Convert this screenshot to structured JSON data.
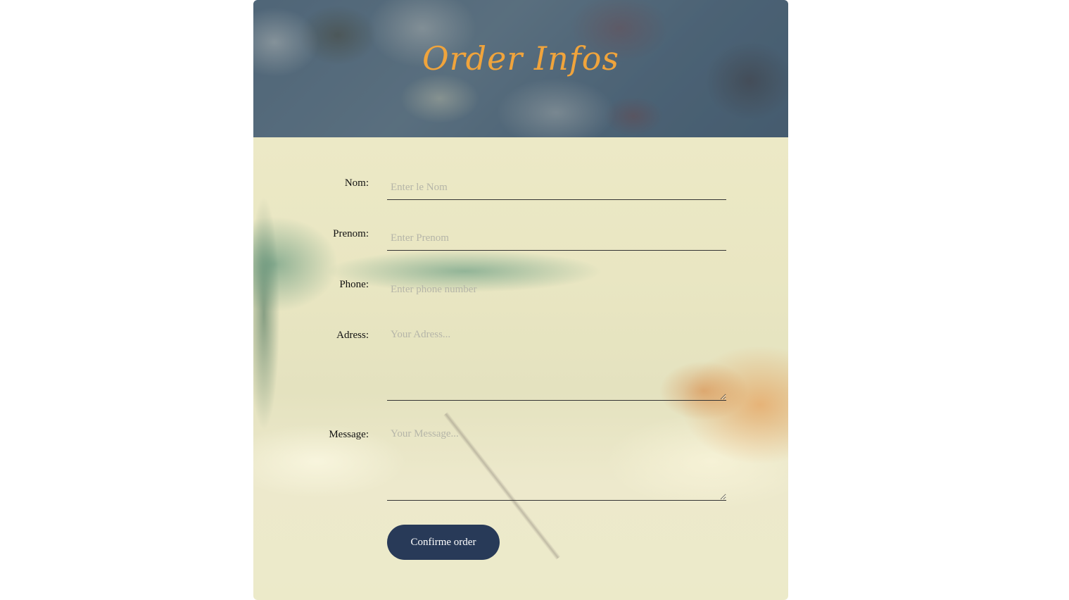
{
  "header": {
    "title": "Order Infos"
  },
  "form": {
    "nom": {
      "label": "Nom:",
      "placeholder": "Enter le Nom"
    },
    "prenom": {
      "label": "Prenom:",
      "placeholder": "Enter Prenom"
    },
    "phone": {
      "label": "Phone:",
      "placeholder": "Enter phone number"
    },
    "adress": {
      "label": "Adress:",
      "placeholder": "Your Adress..."
    },
    "message": {
      "label": "Message:",
      "placeholder": "Your Message..."
    },
    "submit_label": "Confirme order"
  },
  "colors": {
    "title": "#f0a43c",
    "button": "#283a58"
  }
}
